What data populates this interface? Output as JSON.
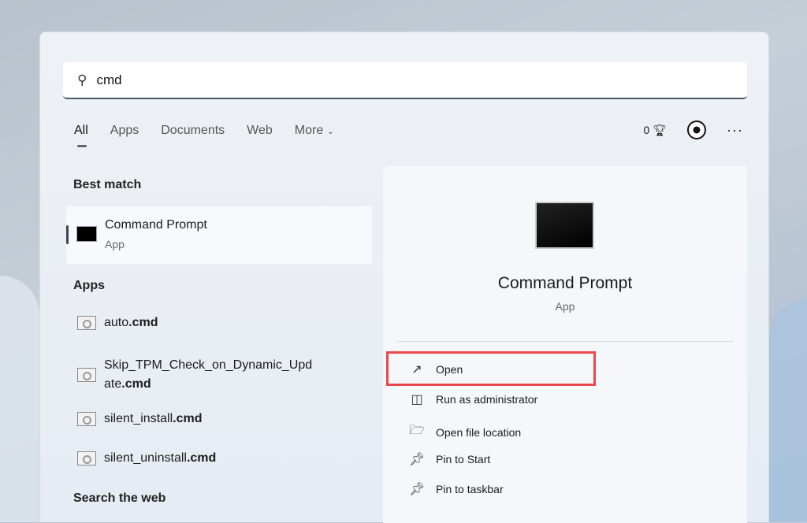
{
  "search": {
    "value": "cmd"
  },
  "tabs": [
    {
      "label": "All"
    },
    {
      "label": "Apps"
    },
    {
      "label": "Documents"
    },
    {
      "label": "Web"
    },
    {
      "label": "More"
    }
  ],
  "header": {
    "points": "0"
  },
  "sections": {
    "best_match": "Best match",
    "apps": "Apps",
    "search_web": "Search the web"
  },
  "best_match": {
    "title": "Command Prompt",
    "subtitle": "App"
  },
  "apps": [
    {
      "name": "auto",
      "ext": ".cmd"
    },
    {
      "name": "Skip_TPM_Check_on_Dynamic_Upd",
      "name2": "ate",
      "ext": ".cmd"
    },
    {
      "name": "silent_install",
      "ext": ".cmd"
    },
    {
      "name": "silent_uninstall",
      "ext": ".cmd"
    }
  ],
  "detail": {
    "title": "Command Prompt",
    "subtitle": "App",
    "actions": [
      {
        "label": "Open"
      },
      {
        "label": "Run as administrator"
      },
      {
        "label": "Open file location"
      },
      {
        "label": "Pin to Start"
      },
      {
        "label": "Pin to taskbar"
      }
    ]
  },
  "colors": {
    "highlight": "#e8494a"
  }
}
